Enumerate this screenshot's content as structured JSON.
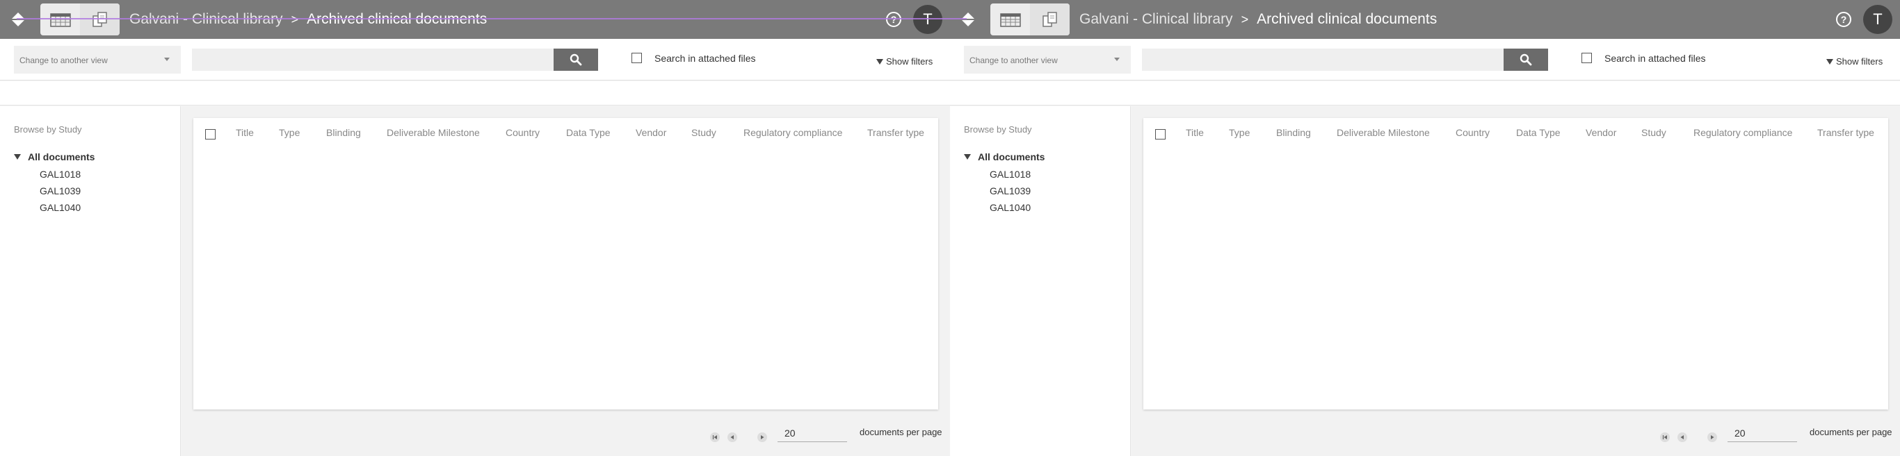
{
  "header": {
    "breadcrumb_lib": "Galvani - Clinical library",
    "breadcrumb_sep": ">",
    "breadcrumb_current": "Archived clinical documents",
    "help": "?",
    "avatar_initial": "T"
  },
  "search": {
    "view_select": "Change to another view",
    "input_placeholder": "",
    "attached_label": "Search in attached files",
    "show_filters": "Show filters"
  },
  "sidebar": {
    "title": "Browse by Study",
    "root": "All documents",
    "items": [
      "GAL1018",
      "GAL1039",
      "GAL1040"
    ]
  },
  "table": {
    "columns": [
      "Title",
      "Type",
      "Blinding",
      "Deliverable Milestone",
      "Country",
      "Data Type",
      "Vendor",
      "Study",
      "Regulatory compliance",
      "Transfer type"
    ]
  },
  "pager": {
    "per_page": "20",
    "per_page_label": "documents per page"
  },
  "colors": {
    "topbar": "#7a7a7a",
    "accent_line": "#b07ae0"
  },
  "icons": [
    "app-switch-icon",
    "calendar-view-icon",
    "copy-view-icon",
    "help-icon",
    "search-icon",
    "first-page-icon",
    "prev-page-icon",
    "next-page-icon"
  ]
}
